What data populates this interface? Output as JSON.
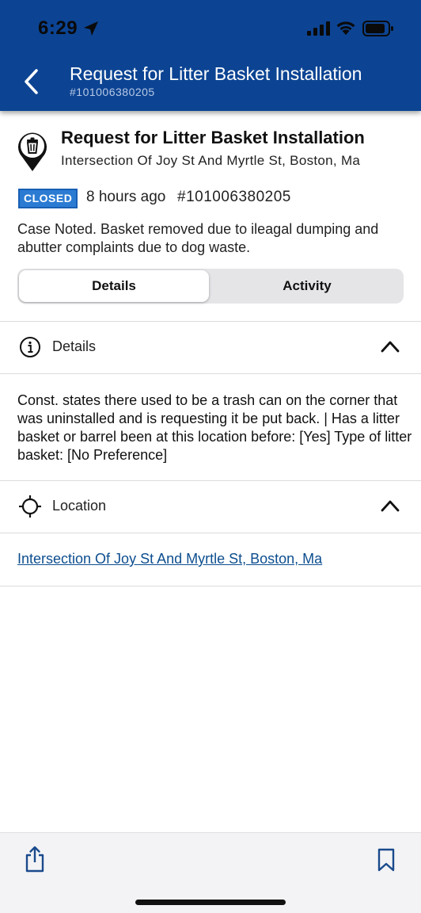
{
  "status_bar": {
    "time": "6:29"
  },
  "header": {
    "title": "Request for Litter Basket Installation",
    "subtitle": "#101006380205"
  },
  "summary": {
    "title": "Request for Litter Basket Installation",
    "address": "Intersection Of Joy St And Myrtle St, Boston, Ma",
    "status_badge": "CLOSED",
    "time_ago": "8 hours ago",
    "case_number": "#101006380205",
    "note": "Case Noted. Basket removed due to ileagal dumping and abutter complaints due to dog waste."
  },
  "tabs": [
    {
      "label": "Details",
      "active": true
    },
    {
      "label": "Activity",
      "active": false
    }
  ],
  "details_section": {
    "label": "Details",
    "icon": "info-icon",
    "text": "Const. states there used to be a trash can on the corner that was uninstalled and is requesting it be put back. | Has a litter basket or barrel been at this location before: [Yes]  Type of litter basket: [No Preference]"
  },
  "location_section": {
    "label": "Location",
    "icon": "crosshair-icon",
    "link": "Intersection Of Joy St And Myrtle St, Boston, Ma"
  },
  "toolbar": {
    "share_icon": "share-icon",
    "bookmark_icon": "bookmark-icon"
  },
  "colors": {
    "header_bg": "#0c4493",
    "badge_bg": "#2b7bd3",
    "link": "#0d4e8f"
  }
}
